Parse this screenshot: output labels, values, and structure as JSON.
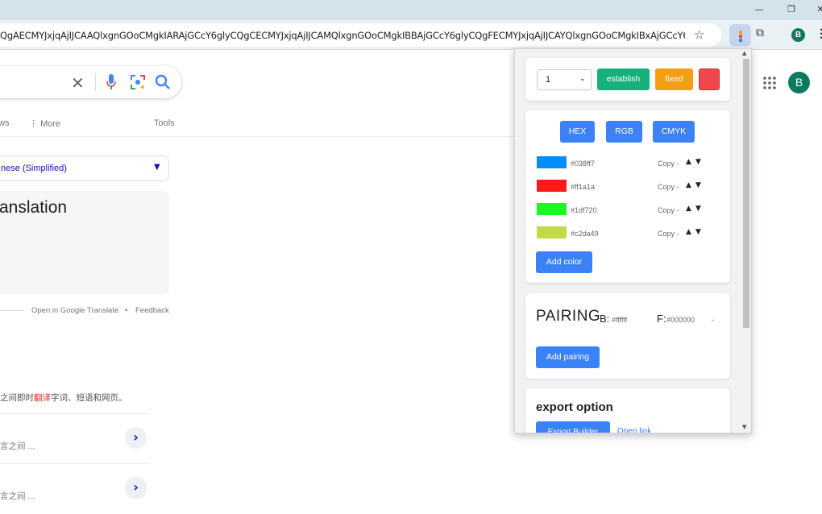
{
  "browser": {
    "url": "QgAECMYJxjqAjIJCAAQlxgnGOoCMgkIARAjGCcY6glyCQgCECMYJxjqAjIJCAMQlxgnGOoCMgkIBBAjGCcY6glyCQgFECMYJxjqAjIJCAYQlxgnGOoCMgkIBxAjGCcY6...",
    "star_icon": "bookmark-star-icon",
    "extensions_icon": "puzzle-icon",
    "profile_initial": "B",
    "window_controls": [
      "minimize",
      "restore",
      "close"
    ]
  },
  "google": {
    "tabs": [
      "ws",
      "More",
      "Tools"
    ],
    "language": "nese (Simplified)",
    "translation_heading": "ranslation",
    "open_in_translate": "Open in Google Translate",
    "dot": "•",
    "feedback": "Feedback",
    "snippet_pre": "之间即时",
    "snippet_highlight": "翻译",
    "snippet_post": "字词、短语和网页。",
    "results": [
      {
        "text": "言之间 ..."
      },
      {
        "text": "言之间 ..."
      }
    ],
    "profile_initial": "B"
  },
  "popup": {
    "top_card": {
      "select_value": "1",
      "establish_label": "establish",
      "fixed_label": "fixed",
      "swatch_color": "#f0474b"
    },
    "format_buttons": [
      "HEX",
      "RGB",
      "CMYK"
    ],
    "colors": [
      {
        "hex": "#038ff7",
        "copy": "Copy -"
      },
      {
        "hex": "#ff1a1a",
        "copy": "Copy -"
      },
      {
        "hex": "#1df720",
        "copy": "Copy -"
      },
      {
        "hex": "#c2da49",
        "copy": "Copy -"
      }
    ],
    "add_color_label": "Add color",
    "pairing": {
      "title": "PAIRING",
      "b_label": "B:",
      "b_value": "#ffffff",
      "f_label": "F:",
      "f_value": "#000000",
      "dash": "-",
      "add_label": "Add pairing"
    },
    "export": {
      "title": "export option",
      "builder_label": "Export Builder",
      "link_label": "Open link"
    }
  },
  "colors": {
    "accent_blue": "#3b82f6",
    "green": "#17b07c",
    "orange": "#f49e12"
  }
}
